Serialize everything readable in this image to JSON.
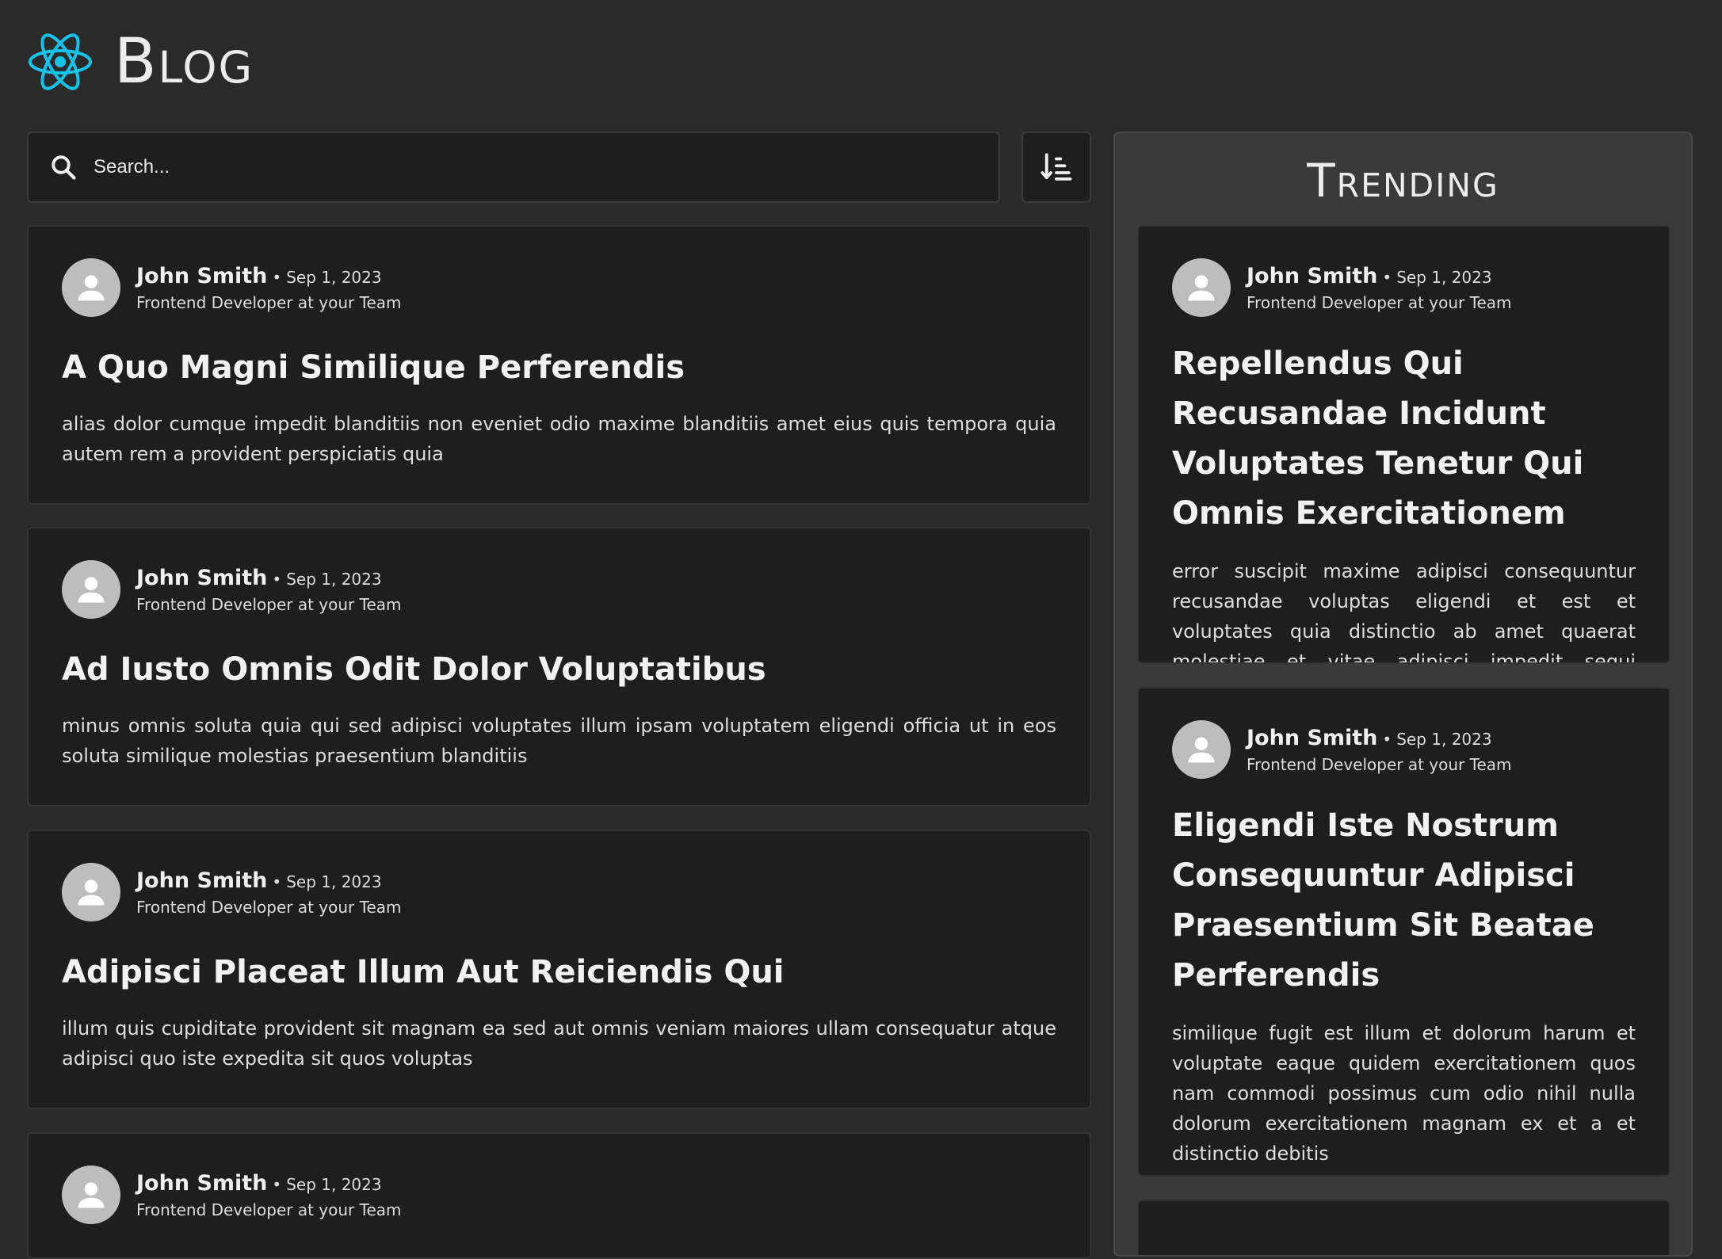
{
  "header": {
    "brand": "Blog",
    "logo_icon": "react-atom-icon",
    "logo_color": "#16c2e8"
  },
  "search": {
    "placeholder": "Search...",
    "icon": "search-icon",
    "sort_icon": "sort-ascending-icon"
  },
  "feed": {
    "posts": [
      {
        "author": "John Smith",
        "date": "Sep 1, 2023",
        "role": "Frontend Developer at your Team",
        "title": "A Quo Magni Similique Perferendis",
        "excerpt": "alias dolor cumque impedit blanditiis non eveniet odio maxime blanditiis amet eius quis tempora quia autem rem a provident perspiciatis quia"
      },
      {
        "author": "John Smith",
        "date": "Sep 1, 2023",
        "role": "Frontend Developer at your Team",
        "title": "Ad Iusto Omnis Odit Dolor Voluptatibus",
        "excerpt": "minus omnis soluta quia qui sed adipisci voluptates illum ipsam voluptatem eligendi officia ut in eos soluta similique molestias praesentium blanditiis"
      },
      {
        "author": "John Smith",
        "date": "Sep 1, 2023",
        "role": "Frontend Developer at your Team",
        "title": "Adipisci Placeat Illum Aut Reiciendis Qui",
        "excerpt": "illum quis cupiditate provident sit magnam ea sed aut omnis veniam maiores ullam consequatur atque adipisci quo iste expedita sit quos voluptas"
      },
      {
        "author": "John Smith",
        "date": "Sep 1, 2023",
        "role": "Frontend Developer at your Team"
      }
    ]
  },
  "trending": {
    "heading": "Trending",
    "posts": [
      {
        "author": "John Smith",
        "date": "Sep 1, 2023",
        "role": "Frontend Developer at your Team",
        "title": "Repellendus Qui Recusandae Incidunt Voluptates Tenetur Qui Omnis Exercitationem",
        "excerpt": "error suscipit maxime adipisci consequuntur recusandae voluptas eligendi et est et voluptates quia distinctio ab amet quaerat molestiae et vitae adipisci impedit sequi nesciunt quis consectetur"
      },
      {
        "author": "John Smith",
        "date": "Sep 1, 2023",
        "role": "Frontend Developer at your Team",
        "title": "Eligendi Iste Nostrum Consequuntur Adipisci Praesentium Sit Beatae Perferendis",
        "excerpt": "similique fugit est illum et dolorum harum et voluptate eaque quidem exercitationem quos nam commodi possimus cum odio nihil nulla dolorum exercitationem magnam ex et a et distinctio debitis"
      }
    ]
  }
}
